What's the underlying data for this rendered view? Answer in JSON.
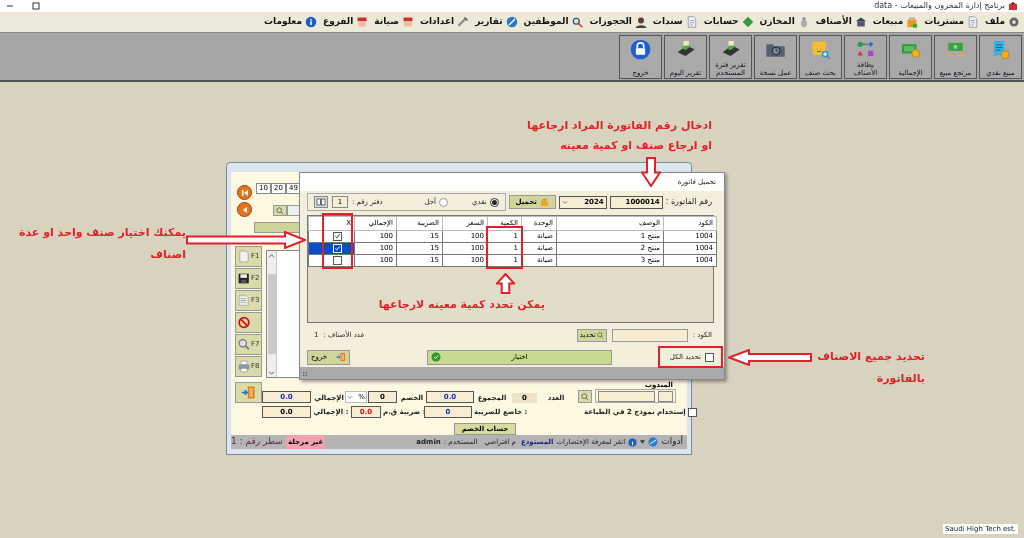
{
  "window": {
    "title": "برنامج إدارة المخزون والمبيعات - data"
  },
  "menu": [
    "ملف",
    "مشتريات",
    "مبيعات",
    "الأصناف",
    "المخازن",
    "حسابات",
    "سندات",
    "الحجوزات",
    "الموظفين",
    "تقارير",
    "اعدادات",
    "صيانة",
    "الفروع",
    "معلومات"
  ],
  "toolbar": [
    "مبيع نقدي",
    "مرتجع مبيع",
    "الإجمالية",
    "بطاقة الأصناف",
    "بحث صنف",
    "عمل نسخة",
    "تقرير فترة المستخدم",
    "تقرير اليوم",
    "خروج"
  ],
  "sales_form": {
    "nav_fields": [
      "49",
      "20",
      "10"
    ],
    "side_buttons": [
      {
        "kind": "new",
        "key": "F1"
      },
      {
        "kind": "save",
        "key": "F2"
      },
      {
        "kind": "list",
        "key": "F3"
      },
      {
        "kind": "cancel"
      },
      {
        "kind": "search",
        "key": "F7"
      },
      {
        "kind": "print",
        "key": "F8"
      }
    ],
    "totals": {
      "total": "0.0",
      "total_label": "الإجمالي",
      "percent": "%",
      "discount": "0",
      "discount_label": "الخصم",
      "sum": "0.0",
      "sum_label": "المجموع",
      "count": "0",
      "count_label": "العدد",
      "rep_label": "المندوب",
      "net": "0.0",
      "net_label": "الإجمالي :",
      "vat": "0.0",
      "vat_label": "ضريبة ق.م :",
      "taxable": "0",
      "taxable_label": "خاضع للضريبة :"
    },
    "print_option": {
      "label": "إستخدام نموذج 2 في الطباعة",
      "checked": false
    },
    "discount_button": "حساب الخصم",
    "status_bar": {
      "posted": "غير مرحلة",
      "line": "سطر رقم : 1",
      "tools": "أدوات",
      "shortcuts": "انقر لمعرفة الإختصارات",
      "warehouse_label": "المستودع",
      "warehouse": "م افتراضي",
      "user_label": "المستخدم :",
      "user": "admin"
    }
  },
  "dialog": {
    "title": "تحميل فاتورة",
    "invoice_label": "رقم الفاتورة :",
    "invoice_number": "1000014",
    "year": "2024",
    "load_button": "تحميل",
    "payment": [
      {
        "label": "نقدي",
        "selected": true
      },
      {
        "label": "آجل",
        "selected": false
      }
    ],
    "book_label": "دفتر رقم :",
    "book_number": "1",
    "columns": [
      "الكود",
      "الوصف",
      "الوحدة",
      "الكمية",
      "السعر",
      "الضريبة",
      "الإجمالي",
      "X"
    ],
    "rows": [
      {
        "cells": [
          "1004",
          "منتج 1",
          "صيانة",
          "1",
          "100",
          "15",
          "100"
        ],
        "checked": true,
        "selected": false
      },
      {
        "cells": [
          "1004",
          "منتج 2",
          "صيانة",
          "1",
          "100",
          "15",
          "100"
        ],
        "checked": true,
        "selected": true
      },
      {
        "cells": [
          "1004",
          "منتج 3",
          "صيانة",
          "1",
          "100",
          "15",
          "100"
        ],
        "checked": false,
        "selected": false
      }
    ],
    "code_label": "الكود :",
    "select_button": "تحديد",
    "items_count_label": "عدد الأصناف :",
    "items_count": "1",
    "select_all": {
      "label": "تحديد الكل",
      "checked": false
    },
    "choose_button": "اختيار",
    "exit_button": "خروج"
  },
  "annotations": [
    {
      "text": "ادخال رقم الفاتورة المراد ارجاعها\nاو ارجاع صنف او كمية معينه"
    },
    {
      "text": "يمكنك اختيار صنف واحد او عدة\nاصناف"
    },
    {
      "text": "يمكن تحدد كمية معينه لارجاعها"
    },
    {
      "text": "تحديد جميع الاصناف\nبالفاتورة"
    }
  ],
  "footer": "Saudi High Tech est."
}
